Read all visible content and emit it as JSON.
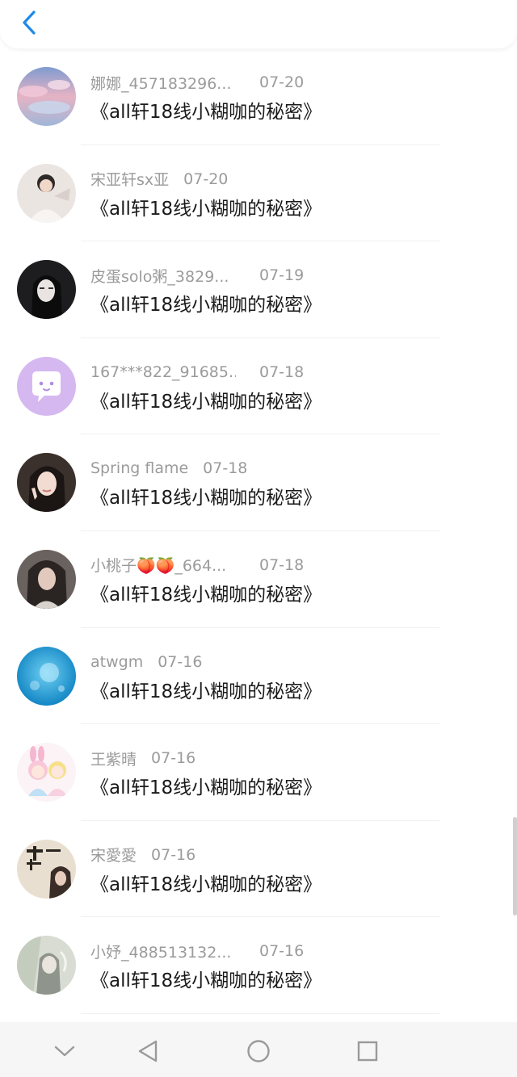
{
  "colors": {
    "accent": "#1e8ae8",
    "meta_text": "#9b9b9b",
    "message_text": "#1a1a1a"
  },
  "header": {
    "back_icon": "chevron-left-icon"
  },
  "items": [
    {
      "name": "娜娜_457183296...",
      "date": "07-20",
      "message": "《all轩18线小糊咖的秘密》"
    },
    {
      "name": "宋亚轩sx亚",
      "date": "07-20",
      "message": "《all轩18线小糊咖的秘密》"
    },
    {
      "name": "皮蛋solo粥_3829...",
      "date": "07-19",
      "message": "《all轩18线小糊咖的秘密》"
    },
    {
      "name": "167***822_91685...",
      "date": "07-18",
      "message": "《all轩18线小糊咖的秘密》"
    },
    {
      "name": "Spring flame",
      "date": "07-18",
      "message": "《all轩18线小糊咖的秘密》"
    },
    {
      "name": "小桃子🍑🍑_664...",
      "date": "07-18",
      "message": "《all轩18线小糊咖的秘密》"
    },
    {
      "name": "atwgm",
      "date": "07-16",
      "message": "《all轩18线小糊咖的秘密》"
    },
    {
      "name": "王紫晴",
      "date": "07-16",
      "message": "《all轩18线小糊咖的秘密》"
    },
    {
      "name": "宋愛愛",
      "date": "07-16",
      "message": "《all轩18线小糊咖的秘密》"
    },
    {
      "name": "小妤_488513132...",
      "date": "07-16",
      "message": "《all轩18线小糊咖的秘密》"
    }
  ],
  "navbar": {
    "icons": [
      "chevron-down-icon",
      "back-triangle-icon",
      "home-circle-icon",
      "recents-square-icon"
    ]
  }
}
